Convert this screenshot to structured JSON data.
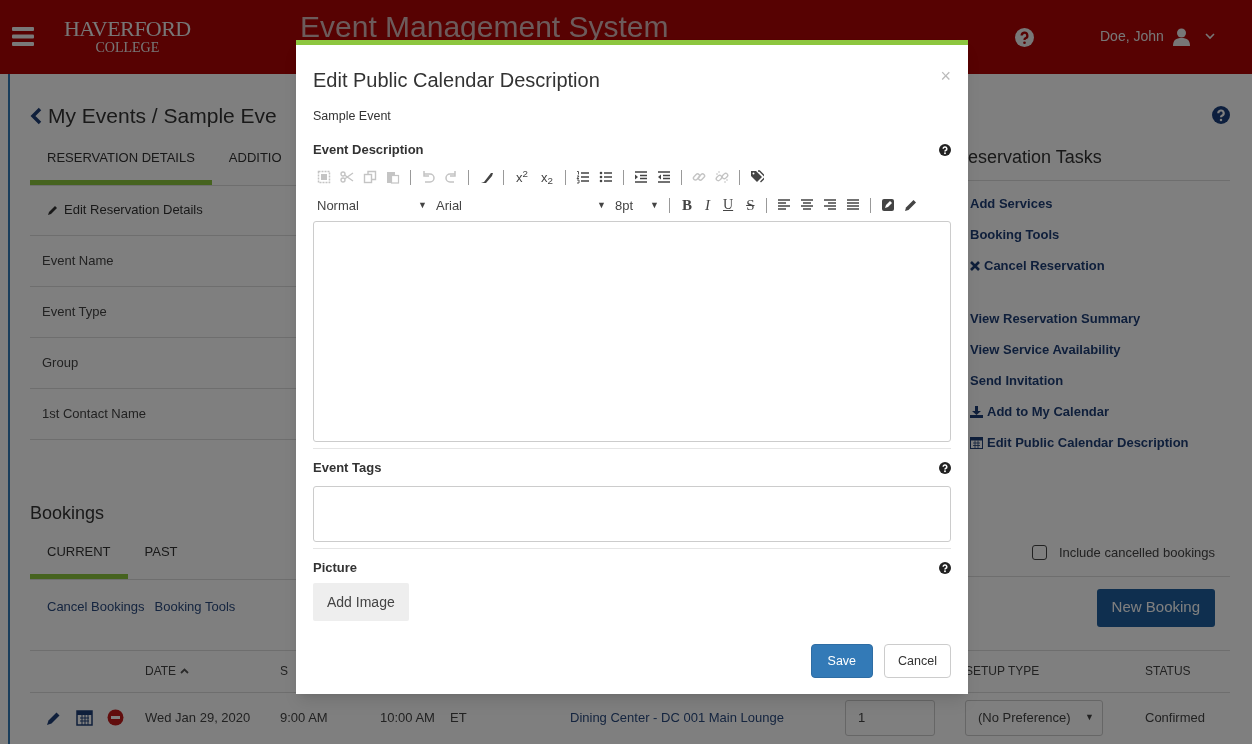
{
  "header": {
    "brand": [
      "HAVERFORD",
      "COLLEGE"
    ],
    "title": "Event Management System",
    "user": "Doe, John"
  },
  "breadcrumb": "My Events / Sample Eve",
  "detail_tabs": [
    {
      "label": "RESERVATION DETAILS",
      "selected": true
    },
    {
      "label": "ADDITIO",
      "selected": false
    }
  ],
  "edit_link": "Edit Reservation Details",
  "detail_rows": [
    "Event Name",
    "Event Type",
    "Group",
    "1st Contact Name"
  ],
  "tasks": {
    "title": "eservation Tasks",
    "groups": [
      [
        {
          "label": "Add Services",
          "kind": "plain"
        },
        {
          "label": "Booking Tools",
          "kind": "plain"
        },
        {
          "label": "Cancel Reservation",
          "kind": "close"
        }
      ],
      [
        {
          "label": "View Reservation Summary",
          "kind": "plain"
        },
        {
          "label": "View Service Availability",
          "kind": "plain"
        },
        {
          "label": "Send Invitation",
          "kind": "plain"
        },
        {
          "label": "Add to My Calendar",
          "kind": "download"
        },
        {
          "label": "Edit Public Calendar Description",
          "kind": "calendar"
        }
      ]
    ]
  },
  "bookings": {
    "title": "Bookings",
    "tabs": [
      {
        "label": "CURRENT",
        "selected": true
      },
      {
        "label": "PAST",
        "selected": false
      }
    ],
    "actions": [
      "Cancel Bookings",
      "Booking Tools"
    ],
    "include_cancelled": {
      "label": "Include cancelled bookings",
      "checked": false
    },
    "new_button": "New Booking",
    "columns": [
      {
        "label": "DATE",
        "kind": "sorted"
      },
      {
        "label": "S",
        "kind": "plain"
      },
      {
        "label": "SETUP TYPE",
        "kind": "plain"
      },
      {
        "label": "STATUS",
        "kind": "plain"
      }
    ],
    "rows": [
      {
        "date": "Wed Jan 29, 2020",
        "start": "9:00 AM",
        "end": "10:00 AM",
        "tz": "ET",
        "location": "Dining Center - DC 001 Main Lounge",
        "quantity": "1",
        "setup_type": "(No Preference)",
        "setup_arrow": "▼",
        "status": "Confirmed"
      }
    ]
  },
  "modal": {
    "title": "Edit Public Calendar Description",
    "close": "×",
    "subtitle": "Sample Event",
    "sections": [
      {
        "label": "Event Description",
        "kind": "editor"
      },
      {
        "label": "Event Tags",
        "kind": "input"
      },
      {
        "label": "Picture",
        "kind": "image",
        "button": "Add Image"
      }
    ],
    "toolbar": [
      [
        {
          "kind": "select-all",
          "disabled": true
        },
        {
          "kind": "cut",
          "disabled": true
        },
        {
          "kind": "copy",
          "disabled": true
        },
        {
          "kind": "paste",
          "disabled": true
        },
        {
          "kind": "separator"
        },
        {
          "kind": "undo",
          "disabled": true
        },
        {
          "kind": "redo",
          "disabled": true
        },
        {
          "kind": "separator"
        },
        {
          "kind": "eraser",
          "disabled": false
        },
        {
          "kind": "separator"
        },
        {
          "kind": "superscript",
          "label": "x$^{2}$",
          "disabled": false
        },
        {
          "kind": "subscript",
          "label": "x$_{2}$",
          "disabled": false
        },
        {
          "kind": "separator"
        },
        {
          "kind": "numbered-list",
          "disabled": false
        },
        {
          "kind": "bulleted-list",
          "disabled": false
        },
        {
          "kind": "separator"
        },
        {
          "kind": "indent",
          "disabled": false
        },
        {
          "kind": "outdent",
          "disabled": false
        },
        {
          "kind": "separator"
        },
        {
          "kind": "link",
          "disabled": true
        },
        {
          "kind": "unlink",
          "disabled": true
        },
        {
          "kind": "separator"
        },
        {
          "kind": "tags",
          "disabled": false
        }
      ],
      [
        {
          "kind": "dropdown",
          "label": "Normal",
          "arrow": "▼"
        },
        {
          "kind": "dropdown",
          "label": "Arial",
          "arrow": "▼"
        },
        {
          "kind": "dropdown",
          "label": "8pt",
          "arrow": "▼"
        },
        {
          "kind": "separator"
        },
        {
          "kind": "bold",
          "label": "B"
        },
        {
          "kind": "italic",
          "label": "I"
        },
        {
          "kind": "underline",
          "label": "U"
        },
        {
          "kind": "strike",
          "label": "S"
        },
        {
          "kind": "separator"
        },
        {
          "kind": "align-left"
        },
        {
          "kind": "align-center"
        },
        {
          "kind": "align-right"
        },
        {
          "kind": "align-justify"
        },
        {
          "kind": "separator"
        },
        {
          "kind": "fill"
        },
        {
          "kind": "pencil"
        }
      ]
    ],
    "buttons": [
      {
        "label": "Save",
        "kind": "primary"
      },
      {
        "label": "Cancel",
        "kind": "default"
      }
    ]
  }
}
